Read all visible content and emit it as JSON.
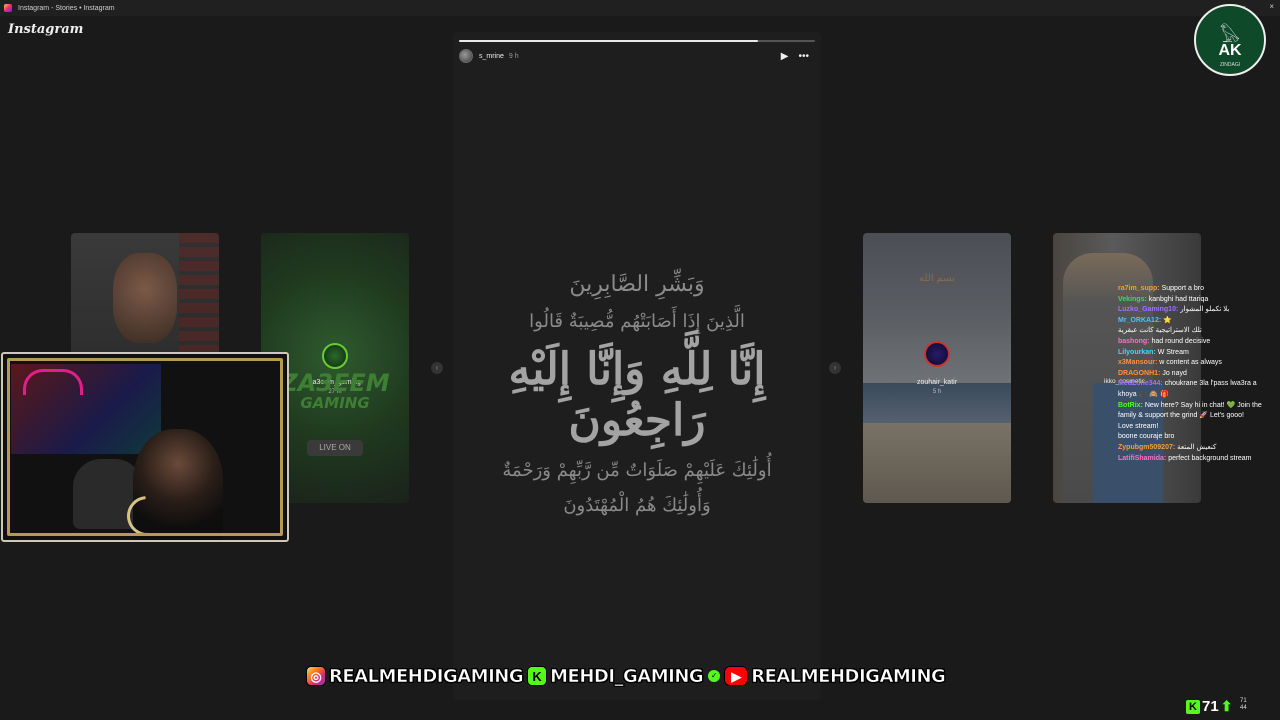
{
  "window": {
    "title": "Instagram - Stories • Instagram",
    "minimize": "–",
    "close": "×"
  },
  "app": {
    "logo": "Instagram"
  },
  "story": {
    "username": "s_mrine",
    "time": "9 h",
    "progress": 0.84,
    "play_icon": "play-icon",
    "more_icon": "more-icon",
    "text_lines": [
      "وَبَشِّرِ الصَّابِرِينَ",
      "الَّذِينَ إِذَا أَصَابَتْهُم مُّصِيبَةٌ قَالُوا",
      "إِنَّا لِلَّهِ وَإِنَّا إِلَيْهِ رَاجِعُونَ",
      "أُولَٰئِكَ عَلَيْهِمْ صَلَوَاتٌ مِّن رَّبِّهِمْ وَرَحْمَةٌ",
      "وَأُولَٰئِكَ هُمُ الْمُهْتَدُونَ"
    ]
  },
  "nav": {
    "prev": "‹",
    "next": "›"
  },
  "cards": {
    "za3eem": {
      "name": "za3eem_gaming",
      "time": "27 m",
      "logo_line1": "ZA3EEM",
      "logo_line2": "GAMING",
      "live": "LIVE ON"
    },
    "zouhair": {
      "name": "zouhair_katir",
      "time": "5 h",
      "overlay_text": "بسم الله"
    },
    "ikko": {
      "name": "ikko_cosmetic"
    }
  },
  "brand_logo": {
    "wings": "𓅃",
    "mono": "AK",
    "sub": "ZINDAGI"
  },
  "chat": [
    {
      "user": "ra7im_supp:",
      "msg": "Support a bro",
      "color": "#f0a040"
    },
    {
      "user": "Vekings:",
      "msg": "kanbghi had ttariqa",
      "color": "#50d060"
    },
    {
      "user": "Luzko_Gaming10:",
      "msg": "بلا تكملو المشوار",
      "color": "#a070ff"
    },
    {
      "user": "Mr_ORKA12:",
      "msg": "⭐",
      "color": "#50c0ff"
    },
    {
      "user": "",
      "msg": "تلك الاستراتيجية كانت عبقرية",
      "color": "#ff5050"
    },
    {
      "user": "bashong:",
      "msg": "had round decisive",
      "color": "#ff70c0"
    },
    {
      "user": "Lilyourkan:",
      "msg": "W Stream",
      "color": "#50d0ff"
    },
    {
      "user": "x3Mansour:",
      "msg": "w content as always",
      "color": "#ff9040"
    },
    {
      "user": "DRAGONH1:",
      "msg": "Jo nayd",
      "color": "#ff9040"
    },
    {
      "user": "MedZone344:",
      "msg": "choukrane 3la l'pass lwa3ra a khoya 🎥 🙈 🎁",
      "color": "#a070ff"
    },
    {
      "user": "BotRix:",
      "msg": "New here? Say hi in chat! 💚 Join the family & support the grind 🚀 Let's gooo!",
      "color": "#53fc18"
    },
    {
      "user": "",
      "msg": "Love stream!",
      "color": "#ff5050"
    },
    {
      "user": "",
      "msg": "boone couraje bro",
      "color": "#ff5050"
    },
    {
      "user": "Zypubgm509207:",
      "msg": "كنعيش المتعة",
      "color": "#f0a040"
    },
    {
      "user": "LatifiShamida:",
      "msg": "perfect background stream",
      "color": "#ff70c0"
    }
  ],
  "banner": {
    "instagram": "REALMEHDIGAMING",
    "kick": "MEHDI_GAMING",
    "youtube": "REALMEHDIGAMING",
    "ig_icon": "◎",
    "kick_icon": "K",
    "yt_icon": "▶",
    "verify": "✓"
  },
  "counter": {
    "icon": "K",
    "value": "71",
    "arrow": "⬆",
    "mini1": "71",
    "mini2": "44"
  }
}
